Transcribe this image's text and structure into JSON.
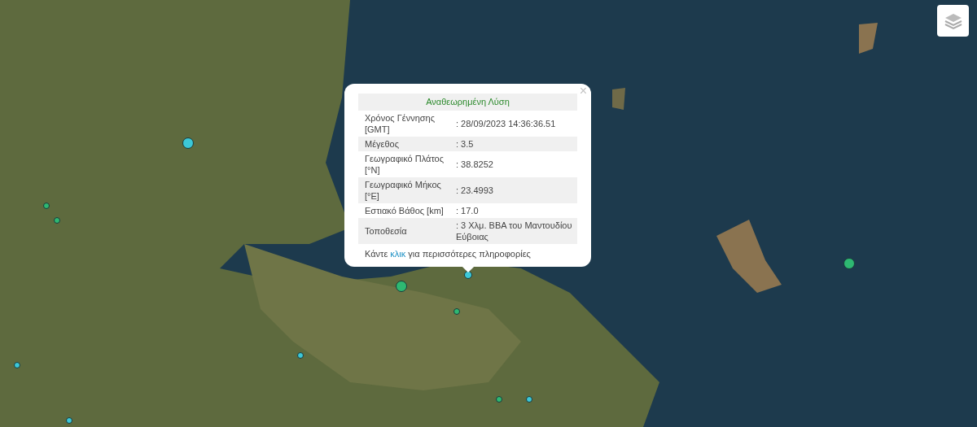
{
  "map": {
    "markers": [
      {
        "color": "#3cc8d8"
      },
      {
        "color": "#2eb872"
      },
      {
        "color": "#2eb872"
      },
      {
        "color": "#2eb872"
      },
      {
        "color": "#2eb872"
      },
      {
        "color": "#3cc8d8"
      },
      {
        "color": "#3cc8d8"
      },
      {
        "color": "#3cc8d8"
      },
      {
        "color": "#2eb872"
      },
      {
        "color": "#3cc8d8"
      },
      {
        "color": "#3cc8d8"
      },
      {
        "color": "#2eb872"
      }
    ]
  },
  "popup": {
    "title": "Αναθεωρημένη Λύση",
    "close": "×",
    "rows": [
      {
        "label": "Χρόνος Γέννησης [GMT]",
        "value": ": 28/09/2023 14:36:36.51"
      },
      {
        "label": "Μέγεθος",
        "value": ": 3.5"
      },
      {
        "label": "Γεωγραφικό Πλάτος [°N]",
        "value": ": 38.8252"
      },
      {
        "label": "Γεωγραφικό Μήκος [°E]",
        "value": ": 23.4993"
      },
      {
        "label": "Εστιακό Βάθος [km]",
        "value": ": 17.0"
      },
      {
        "label": "Τοποθεσία",
        "value": ": 3 Χλμ. ΒΒΑ του Μαντουδίου Εύβοιας"
      }
    ],
    "footer": {
      "before": "Κάντε",
      "link": "κλικ",
      "after": "για περισσότερες πληροφορίες"
    }
  }
}
